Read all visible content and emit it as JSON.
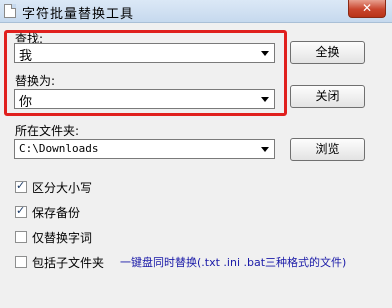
{
  "window": {
    "title": "字符批量替换工具",
    "close_label": "✕"
  },
  "find": {
    "label": "查找:",
    "value": "我"
  },
  "replace": {
    "label": "替换为:",
    "value": "你"
  },
  "folder": {
    "label": "所在文件夹:",
    "value": "C:\\Downloads"
  },
  "buttons": {
    "replace_all": "全换",
    "close": "关闭",
    "browse": "浏览"
  },
  "options": [
    {
      "label": "区分大小写",
      "checked": true
    },
    {
      "label": "保存备份",
      "checked": true
    },
    {
      "label": "仅替换字词",
      "checked": false
    },
    {
      "label": "包括子文件夹",
      "checked": false
    }
  ],
  "note": "一键盘同时替换(.txt .ini .bat三种格式的文件)",
  "colors": {
    "highlight": "#e0201e",
    "note_text": "#1a1aa8"
  }
}
